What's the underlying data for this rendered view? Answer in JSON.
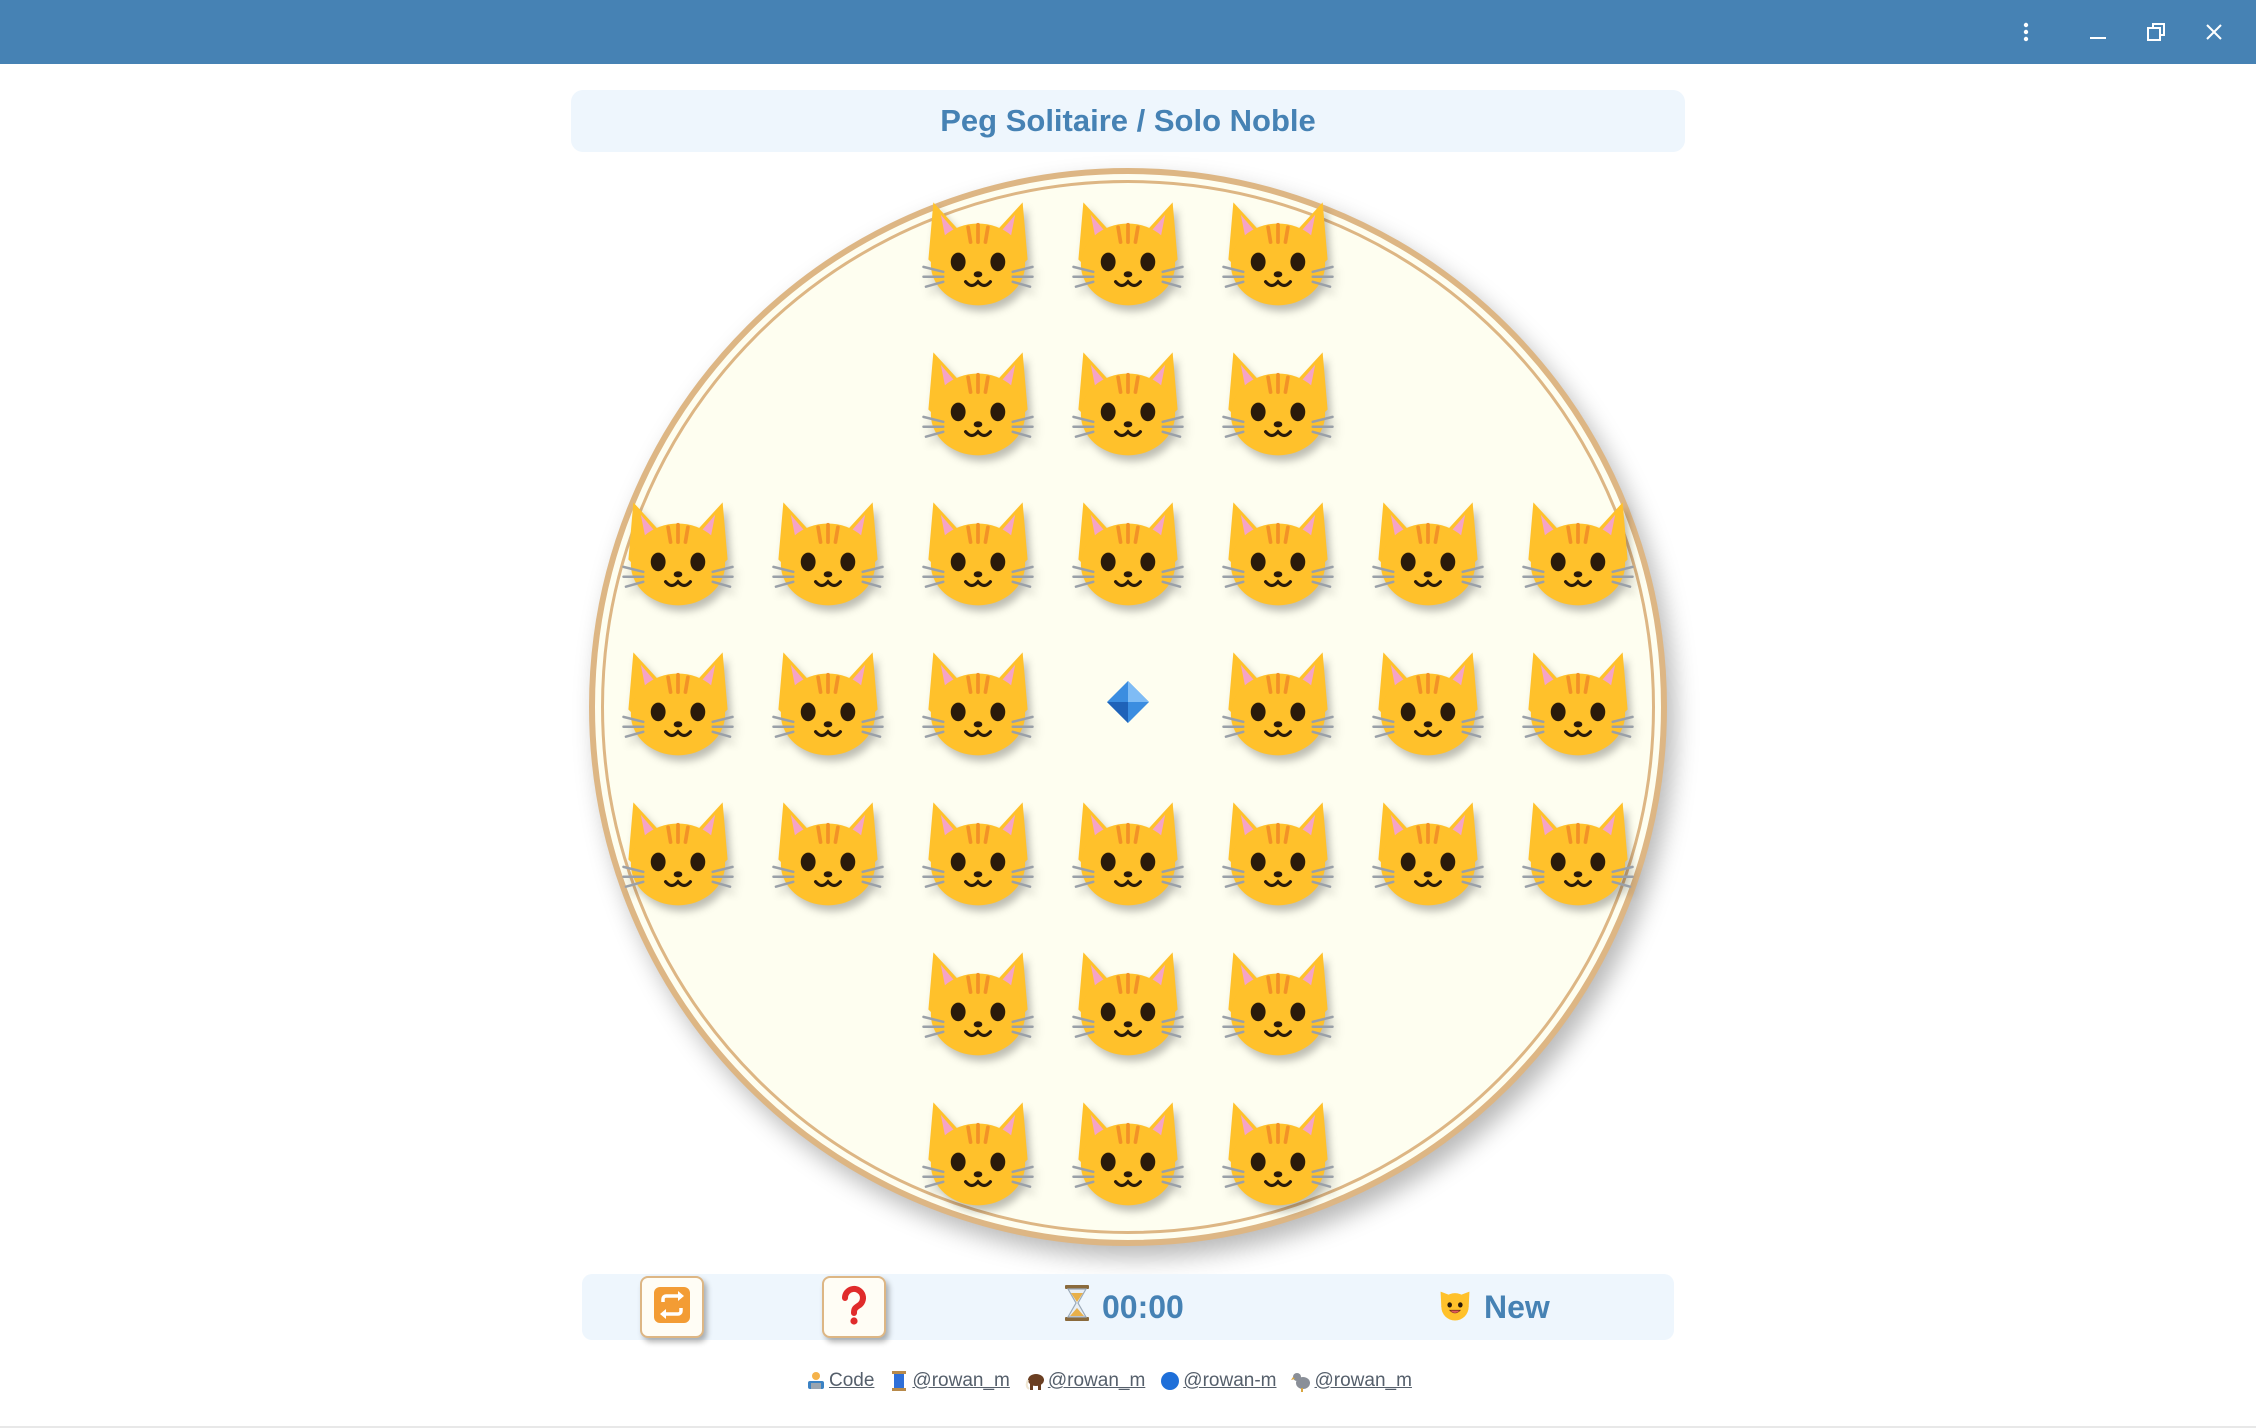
{
  "window": {
    "controls": [
      "more-options",
      "minimize",
      "restore",
      "close"
    ],
    "titlebar_color": "#4682b4"
  },
  "header": {
    "title": "Peg Solitaire / Solo Noble"
  },
  "board": {
    "shape": "english-cross",
    "peg_icon": "cat-face-icon",
    "empty_hole_icon": "blue-diamond-icon",
    "rows": [
      [
        null,
        null,
        "peg",
        "peg",
        "peg",
        null,
        null
      ],
      [
        null,
        null,
        "peg",
        "peg",
        "peg",
        null,
        null
      ],
      [
        "peg",
        "peg",
        "peg",
        "peg",
        "peg",
        "peg",
        "peg"
      ],
      [
        "peg",
        "peg",
        "peg",
        "empty",
        "peg",
        "peg",
        "peg"
      ],
      [
        "peg",
        "peg",
        "peg",
        "peg",
        "peg",
        "peg",
        "peg"
      ],
      [
        null,
        null,
        "peg",
        "peg",
        "peg",
        null,
        null
      ],
      [
        null,
        null,
        "peg",
        "peg",
        "peg",
        null,
        null
      ]
    ],
    "colors": {
      "board_fill": "#fefef0",
      "rim": "#ddb684"
    }
  },
  "controls": {
    "restart_icon": "repeat-arrows-icon",
    "help_icon": "question-mark-icon",
    "timer_icon": "hourglass-icon",
    "timer": "00:00",
    "new_icon": "cat-face-icon",
    "new_label": "New"
  },
  "links": [
    {
      "icon": "technologist-icon",
      "text": "Code"
    },
    {
      "icon": "spool-icon",
      "text": "@rowan_m"
    },
    {
      "icon": "mammoth-icon",
      "text": "@rowan_m"
    },
    {
      "icon": "blue-circle-icon",
      "text": "@rowan-m"
    },
    {
      "icon": "dodo-icon",
      "text": "@rowan_m"
    }
  ]
}
